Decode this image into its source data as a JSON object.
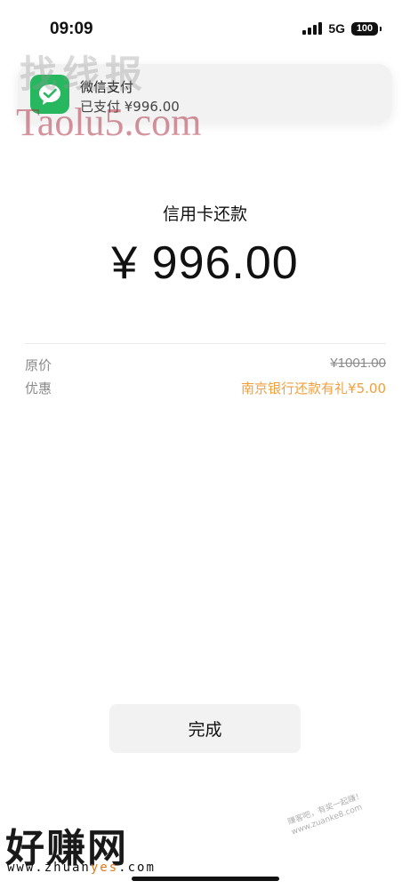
{
  "status_bar": {
    "time": "09:09",
    "network": "5G",
    "battery": "100"
  },
  "notification": {
    "app_icon": "wechat-pay-icon",
    "title": "微信支付",
    "body": "已支付 ¥996.00"
  },
  "payment": {
    "title": "信用卡还款",
    "amount": "¥ 996.00",
    "rows": [
      {
        "label": "原价",
        "value": "¥1001.00"
      },
      {
        "label": "优惠",
        "value": "南京银行还款有礼¥5.00"
      }
    ]
  },
  "done_button": {
    "label": "完成"
  },
  "watermarks": {
    "top_cn": "找线报",
    "top_en": "Taolu5.com",
    "bottom_cn": "好赚网",
    "bottom_url_prefix": "www.zhuan",
    "bottom_url_highlight": "yes",
    "bottom_url_suffix": ".com",
    "bottom_stamp_line1": "赚客吧，有奖一起赚！",
    "bottom_stamp_line2": "www.zuanke8.com"
  },
  "colors": {
    "accent_orange": "#f0a040",
    "wechat_green": "#27b85f",
    "button_bg": "#f2f2f2"
  }
}
